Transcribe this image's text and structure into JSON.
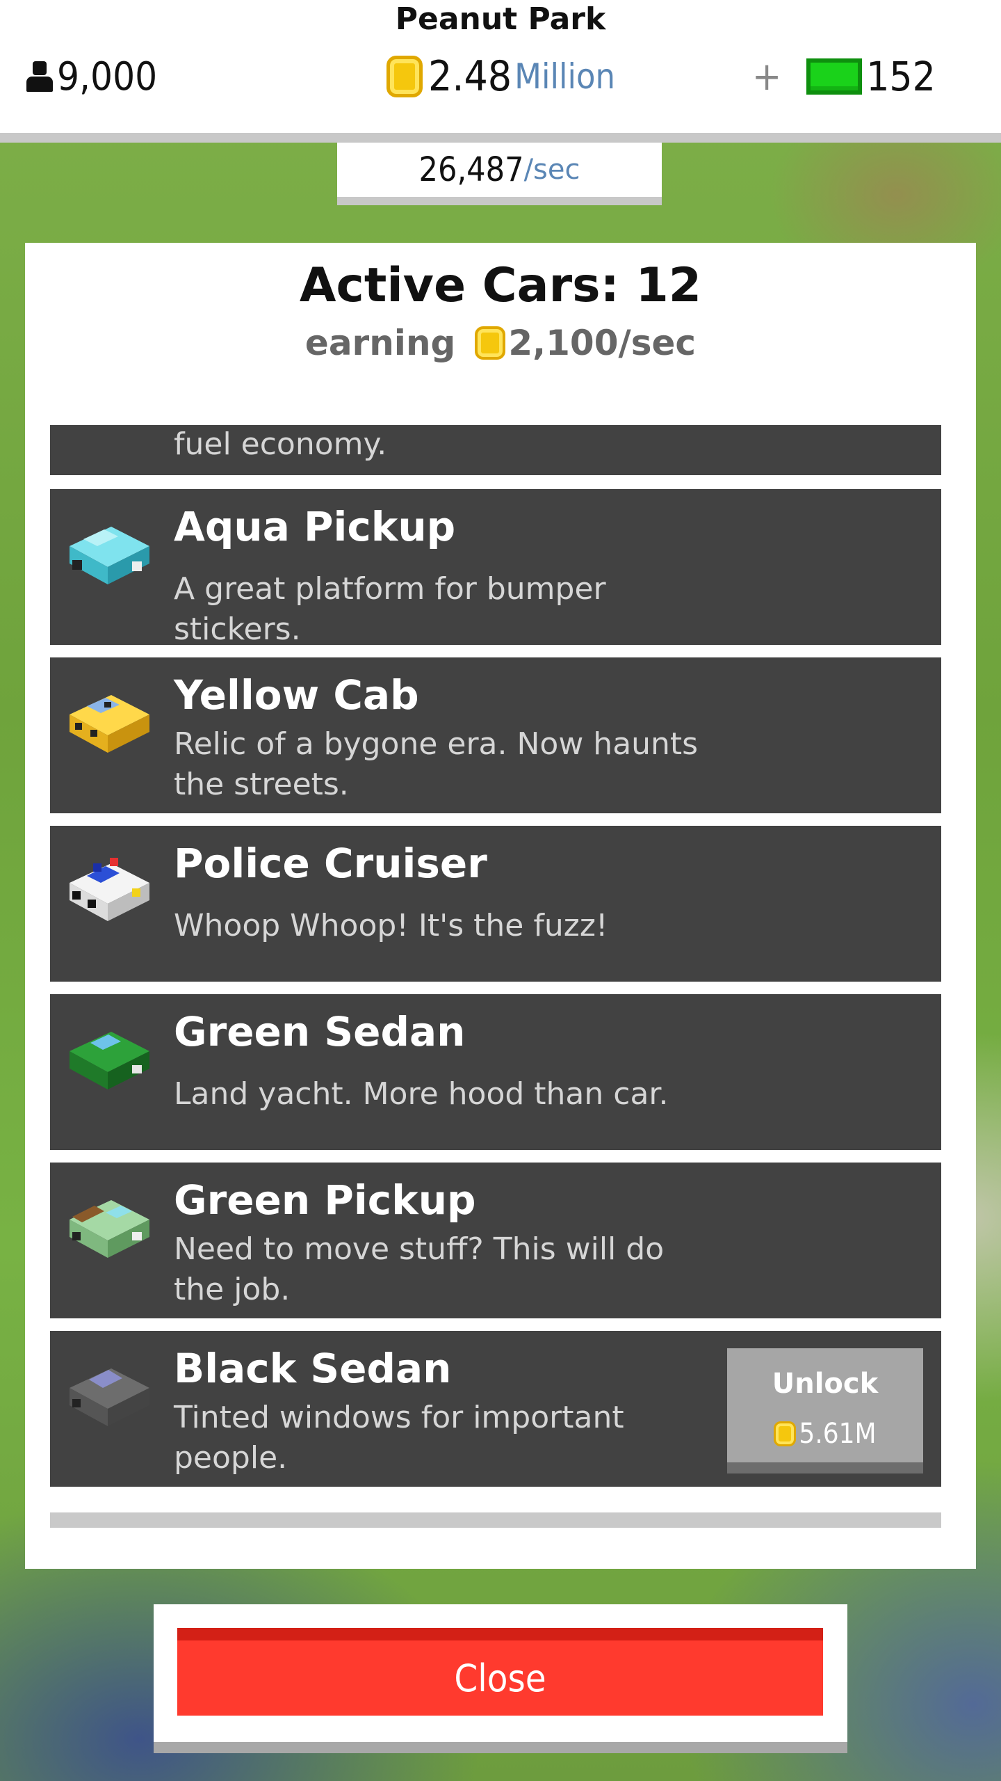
{
  "header": {
    "park_name": "Peanut Park",
    "population": "9,000",
    "money_value": "2.48",
    "money_unit": "Million",
    "plus": "+",
    "gems": "152",
    "rate_value": "26,487",
    "rate_unit": "/sec"
  },
  "panel": {
    "title": "Active Cars: 12",
    "earning_label": "earning",
    "earning_value": "2,100/sec",
    "partial_top_desc": "fuel economy.",
    "cars": [
      {
        "name": "Aqua Pickup",
        "desc": "A great platform for bumper stickers.",
        "icon": "aqua-pickup-icon",
        "color": "#5fd4e0"
      },
      {
        "name": "Yellow Cab",
        "desc": "Relic of a bygone era. Now haunts the streets.",
        "icon": "yellow-cab-icon",
        "color": "#f2c42a"
      },
      {
        "name": "Police Cruiser",
        "desc": "Whoop Whoop! It's the fuzz!",
        "icon": "police-cruiser-icon",
        "color": "#2b4fd6"
      },
      {
        "name": "Green Sedan",
        "desc": "Land yacht. More hood than car.",
        "icon": "green-sedan-icon",
        "color": "#1f8a2a"
      },
      {
        "name": "Green Pickup",
        "desc": "Need to move stuff? This will do the job.",
        "icon": "green-pickup-icon",
        "color": "#8fc98f"
      },
      {
        "name": "Black Sedan",
        "desc": "Tinted windows for important people.",
        "icon": "black-sedan-icon",
        "color": "#6b6f8c"
      }
    ],
    "unlock": {
      "label": "Unlock",
      "price": "5.61M"
    }
  },
  "close_label": "Close",
  "colors": {
    "accent_red": "#ff3a2e",
    "row_bg": "#424242",
    "coin": "#f5c70d",
    "gem": "#1ad21a"
  }
}
